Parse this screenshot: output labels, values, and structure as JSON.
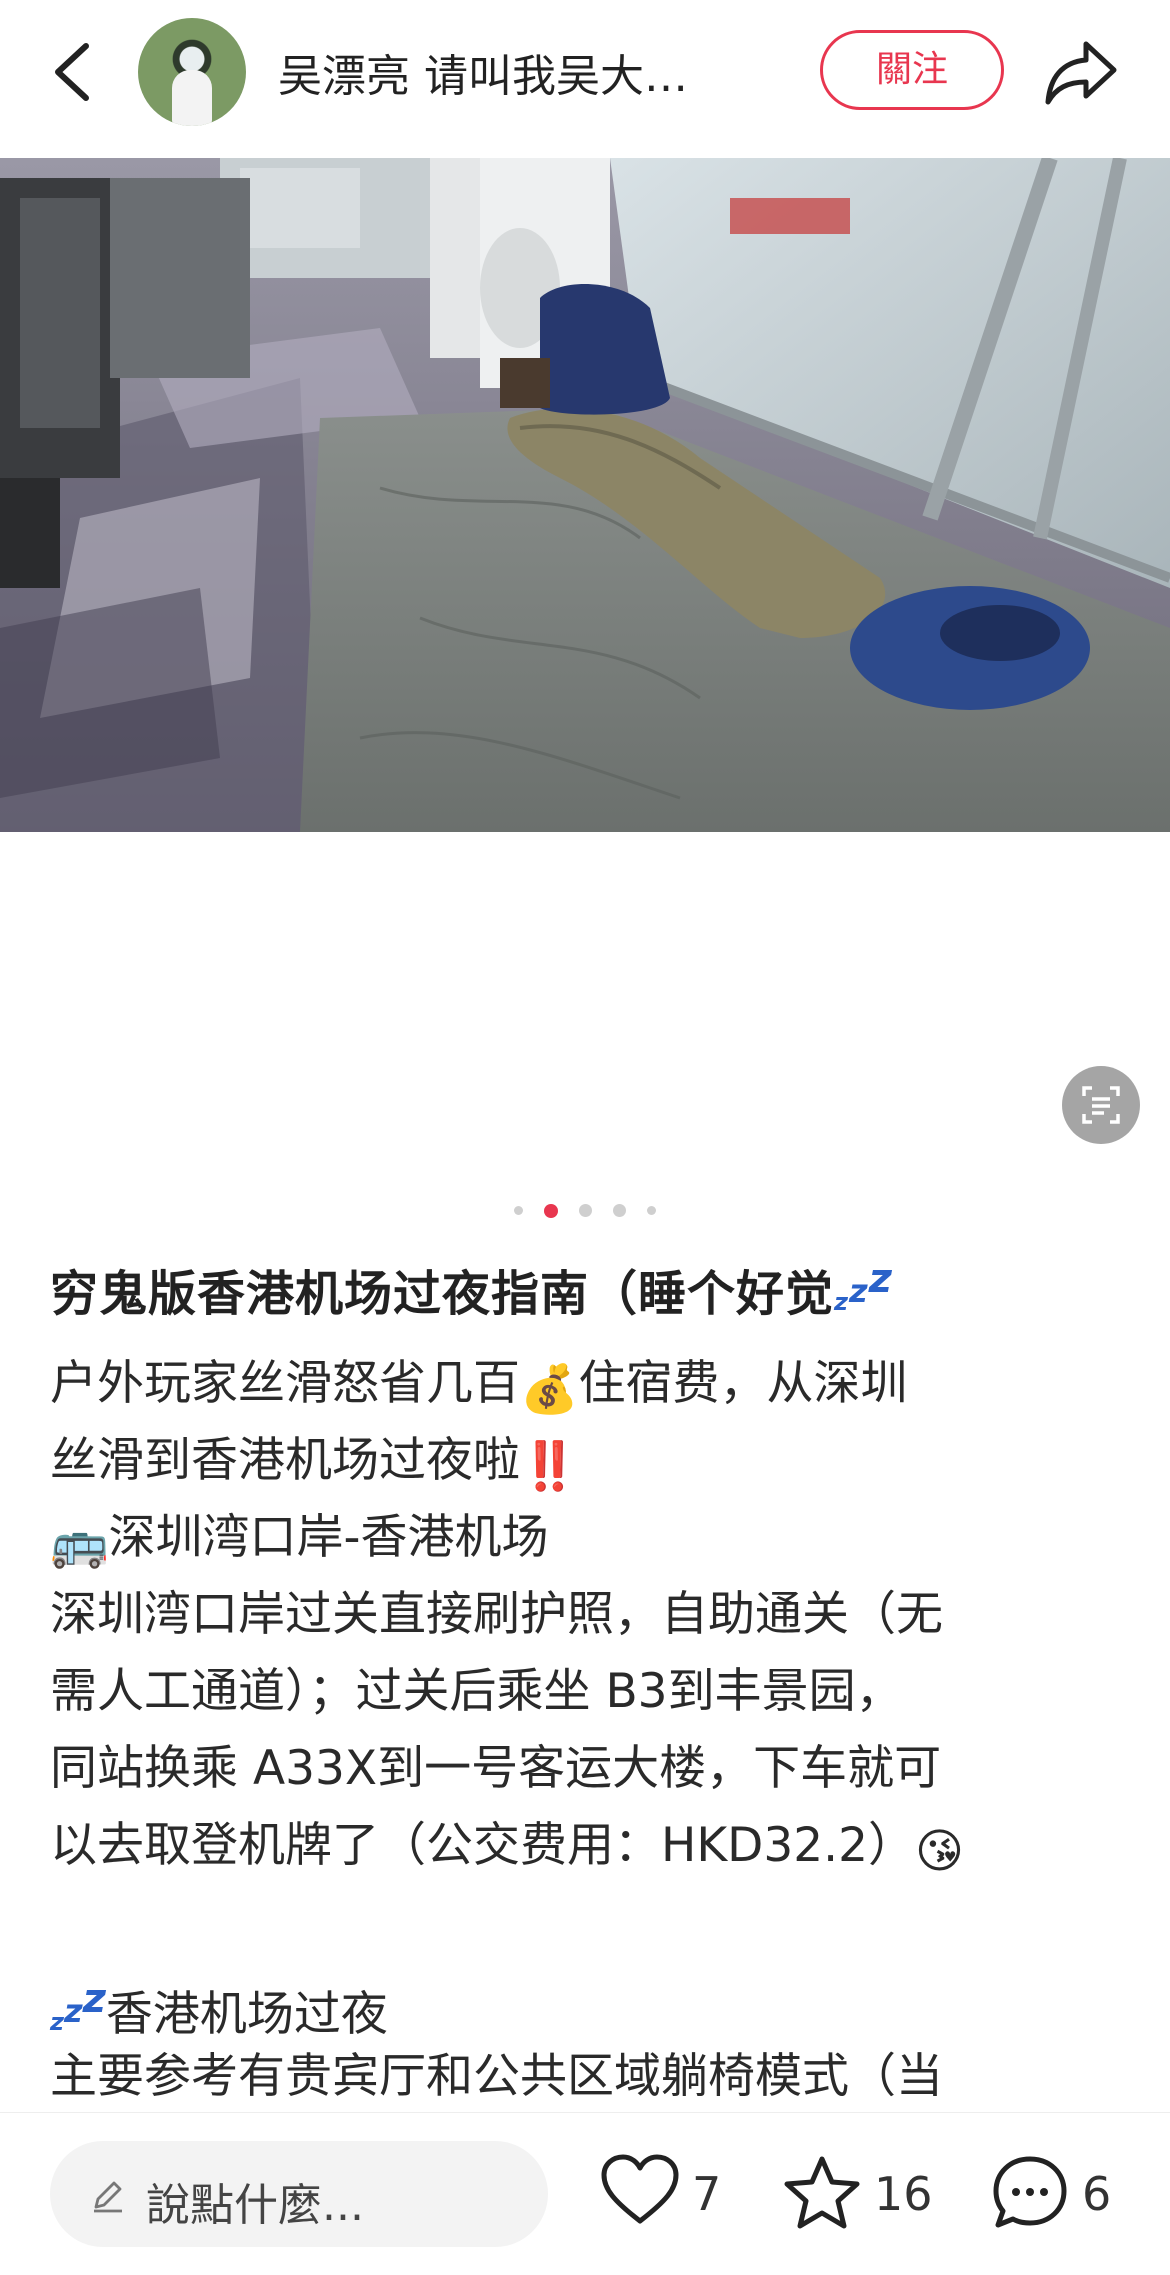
{
  "header": {
    "author_name": "吴漂亮 请叫我吴大…",
    "follow_label": "關注"
  },
  "post": {
    "title_text": "穷鬼版香港机场过夜指南（睡个好觉",
    "lines": [
      {
        "text": "户外玩家丝滑怒省几百",
        "emoji": "💰",
        "after": "住宿费，从深圳"
      },
      {
        "text": "丝滑到香港机场过夜啦",
        "emoji": "‼️",
        "after": ""
      },
      {
        "emoji": "🚌",
        "text": "深圳湾口岸-香港机场"
      },
      {
        "text": "深圳湾口岸过关直接刷护照，自助通关（无"
      },
      {
        "text": "需人工通道）；过关后乘坐 B3到丰景园，"
      },
      {
        "text": "同站换乘 A33X到一号客运大楼，下车就可"
      },
      {
        "text": "以去取登机牌了（公交费用：HKD32.2）",
        "emoji": "😘"
      },
      {
        "text": "香港机场过夜"
      },
      {
        "text": "主要参考有贵宾厅和公共区域躺椅模式（当"
      }
    ]
  },
  "carousel": {
    "total": 5,
    "active": 1
  },
  "bottom": {
    "comment_placeholder": "說點什麼...",
    "likes": "7",
    "collects": "16",
    "comments": "6"
  },
  "icons": {
    "back": "chevron-left-icon",
    "share": "share-arrow-icon",
    "scan": "text-scan-icon",
    "pencil": "pencil-icon",
    "like": "heart-icon",
    "collect": "star-icon",
    "comment": "speech-bubble-icon"
  },
  "colors": {
    "accent": "#e8364f",
    "zz": "#2a62c9"
  }
}
